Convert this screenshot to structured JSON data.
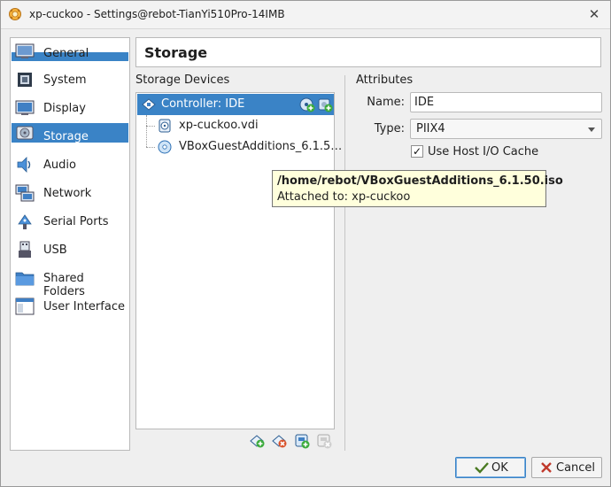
{
  "window": {
    "title": "xp-cuckoo - Settings@rebot-TianYi510Pro-14IMB",
    "close_glyph": "✕"
  },
  "sidebar": {
    "items": [
      {
        "label": "General",
        "icon": "general-icon"
      },
      {
        "label": "System",
        "icon": "system-icon"
      },
      {
        "label": "Display",
        "icon": "display-icon"
      },
      {
        "label": "Storage",
        "icon": "storage-icon",
        "selected": true
      },
      {
        "label": "Audio",
        "icon": "audio-icon"
      },
      {
        "label": "Network",
        "icon": "network-icon"
      },
      {
        "label": "Serial Ports",
        "icon": "serial-ports-icon"
      },
      {
        "label": "USB",
        "icon": "usb-icon"
      },
      {
        "label": "Shared Folders",
        "icon": "shared-folders-icon"
      },
      {
        "label": "User Interface",
        "icon": "user-interface-icon"
      }
    ]
  },
  "header": {
    "title": "Storage"
  },
  "storage_devices": {
    "label": "Storage Devices",
    "tree": [
      {
        "label": "Controller: IDE",
        "icon": "ide-controller-icon",
        "selected": true
      },
      {
        "label": "xp-cuckoo.vdi",
        "icon": "hard-disk-icon"
      },
      {
        "label": "VBoxGuestAdditions_6.1.5…",
        "icon": "optical-disk-icon"
      }
    ]
  },
  "attributes": {
    "label": "Attributes",
    "name_label": "Name:",
    "name_value": "IDE",
    "type_label": "Type:",
    "type_value": "PIIX4",
    "use_host_io_cache_label": "Use Host I/O Cache",
    "use_host_io_cache_checked": true,
    "check_glyph": "✓"
  },
  "tooltip": {
    "path": "/home/rebot/VBoxGuestAdditions_6.1.50.iso",
    "attached": "Attached to: xp-cuckoo"
  },
  "buttons": {
    "ok": "OK",
    "cancel": "Cancel"
  },
  "colors": {
    "selection": "#3a83c6",
    "tooltip_bg": "#ffffdc"
  }
}
